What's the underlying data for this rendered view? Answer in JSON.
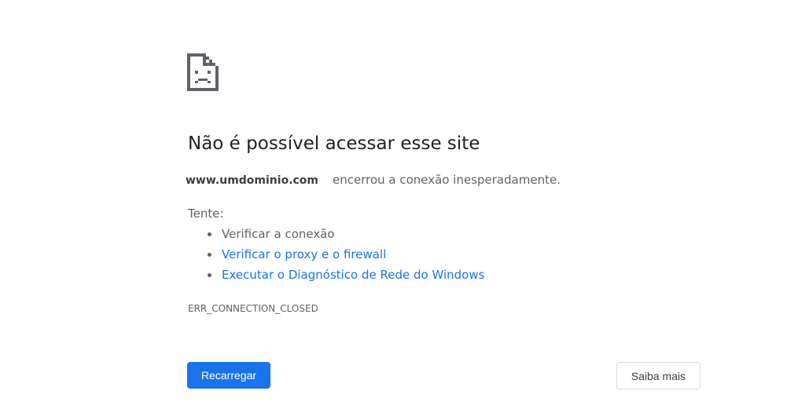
{
  "error": {
    "title": "Não é possível acessar esse site",
    "domain": "www.umdominio.com",
    "description": "encerrou a conexão inesperadamente.",
    "try_label": "Tente:",
    "suggestions": [
      {
        "text": "Verificar a conexão",
        "is_link": false
      },
      {
        "text": "Verificar o proxy e o firewall",
        "is_link": true
      },
      {
        "text": "Executar o Diagnóstico de Rede do Windows",
        "is_link": true
      }
    ],
    "code": "ERR_CONNECTION_CLOSED",
    "icon": "sad-page-icon"
  },
  "buttons": {
    "reload": "Recarregar",
    "learn_more": "Saiba mais"
  },
  "colors": {
    "link": "#1a73e8",
    "primary_button": "#1a73e8",
    "text": "#202124",
    "secondary_text": "#5f6368"
  }
}
